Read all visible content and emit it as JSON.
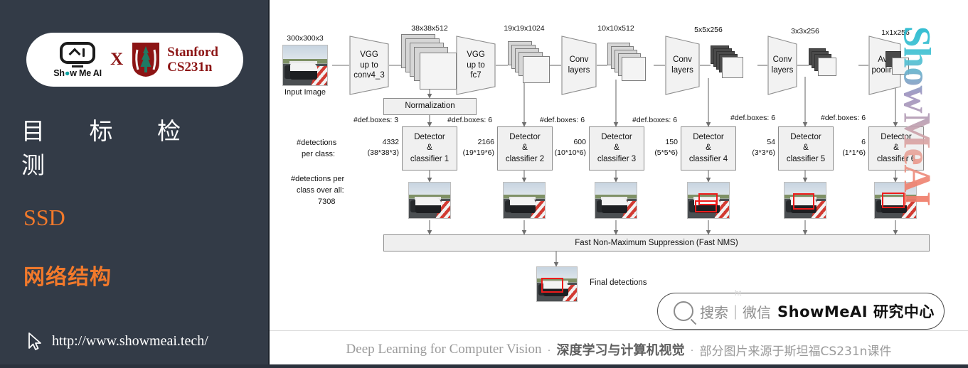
{
  "sidebar": {
    "badge": {
      "brand_name": "Show Me AI",
      "cross": "X",
      "partner_line1": "Stanford",
      "partner_line2": "CS231n"
    },
    "title": "目 标 检 测",
    "topic": "SSD",
    "subtopic": "网络结构",
    "url": "http://www.showmeai.tech/",
    "colors": {
      "background": "#333b47",
      "accent": "#f2792b",
      "stanford_red": "#8c1515"
    }
  },
  "diagram": {
    "input": {
      "size_label": "300x300x3",
      "caption": "Input Image"
    },
    "backbone": [
      {
        "block_label": "VGG\nup to\nconv4_3",
        "output_label": "38x38x512"
      },
      {
        "block_label": "VGG\nup to\nfc7",
        "output_label": "19x19x1024"
      },
      {
        "block_label": "Conv\nlayers",
        "output_label": "10x10x512"
      },
      {
        "block_label": "Conv\nlayers",
        "output_label": "5x5x256"
      },
      {
        "block_label": "Conv\nlayers",
        "output_label": "3x3x256"
      },
      {
        "block_label": "Avg\npooling",
        "output_label": "1x1x256"
      }
    ],
    "normalization_label": "Normalization",
    "detectors": [
      {
        "def_boxes": "#def.boxes: 3",
        "count": "4332",
        "formula": "(38*38*3)",
        "name_line1": "Detector",
        "name_line2": "&",
        "name_line3": "classifier 1",
        "has_detections": false
      },
      {
        "def_boxes": "#def.boxes: 6",
        "count": "2166",
        "formula": "(19*19*6)",
        "name_line1": "Detector",
        "name_line2": "&",
        "name_line3": "classifier 2",
        "has_detections": false
      },
      {
        "def_boxes": "#def.boxes: 6",
        "count": "600",
        "formula": "(10*10*6)",
        "name_line1": "Detector",
        "name_line2": "&",
        "name_line3": "classifier 3",
        "has_detections": false
      },
      {
        "def_boxes": "#def.boxes: 6",
        "count": "150",
        "formula": "(5*5*6)",
        "name_line1": "Detector",
        "name_line2": "&",
        "name_line3": "classifier 4",
        "has_detections": true
      },
      {
        "def_boxes": "#def.boxes: 6",
        "count": "54",
        "formula": "(3*3*6)",
        "name_line1": "Detector",
        "name_line2": "&",
        "name_line3": "classifier 5",
        "has_detections": true
      },
      {
        "def_boxes": "#def.boxes: 6",
        "count": "6",
        "formula": "(1*1*6)",
        "name_line1": "Detector",
        "name_line2": "&",
        "name_line3": "classifier 6",
        "has_detections": true
      }
    ],
    "side_labels": {
      "per_class_line1": "#detections",
      "per_class_line2": "per class:",
      "over_all_line1": "#detections per",
      "over_all_line2": "class over all:",
      "over_all_value": "7308"
    },
    "nms_label": "Fast Non-Maximum Suppression (Fast NMS)",
    "final_label": "Final detections"
  },
  "watermark": "ShowMeAI",
  "search_box": {
    "magnifier": "search-icon",
    "hint": "搜索｜微信",
    "brand": "ShowMeAI 研究中心",
    "ghost": "ht"
  },
  "footer": {
    "part1": "Deep Learning for Computer Vision",
    "sep1": "·",
    "part2": "深度学习与计算机视觉",
    "sep2": "·",
    "part3": "部分图片来源于斯坦福CS231n课件"
  }
}
